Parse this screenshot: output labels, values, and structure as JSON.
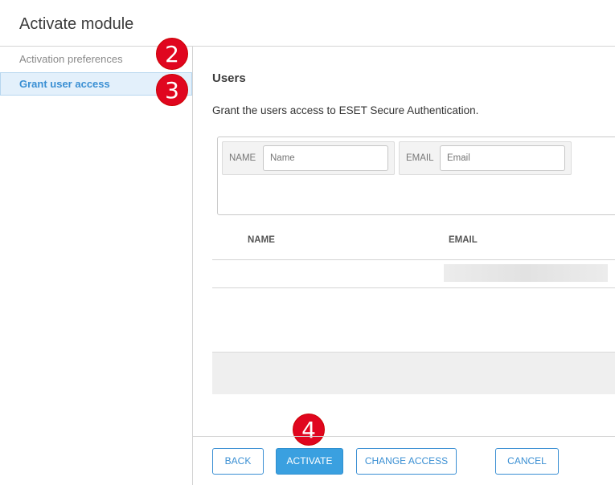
{
  "dialog": {
    "title": "Activate module"
  },
  "sidebar": {
    "items": [
      {
        "label": "Activation preferences",
        "selected": false
      },
      {
        "label": "Grant user access",
        "selected": true
      }
    ]
  },
  "annotations": {
    "step_2": "2",
    "step_3": "3",
    "step_4": "4",
    "color": "#e0061f"
  },
  "main": {
    "section_title": "Users",
    "description": "Grant the users access to ESET Secure Authentication.",
    "filters": {
      "name_label": "NAME",
      "name_placeholder": "Name",
      "email_label": "EMAIL",
      "email_placeholder": "Email"
    },
    "table": {
      "columns": [
        "NAME",
        "EMAIL"
      ],
      "rows": [
        {
          "name": "",
          "email": ""
        }
      ]
    }
  },
  "footer": {
    "back_label": "BACK",
    "activate_label": "ACTIVATE",
    "change_access_label": "CHANGE ACCESS",
    "cancel_label": "CANCEL"
  },
  "colors": {
    "accent": "#3a8fd3",
    "primary_button": "#3aa0e0",
    "selected_nav_bg": "#e3f0fb"
  }
}
